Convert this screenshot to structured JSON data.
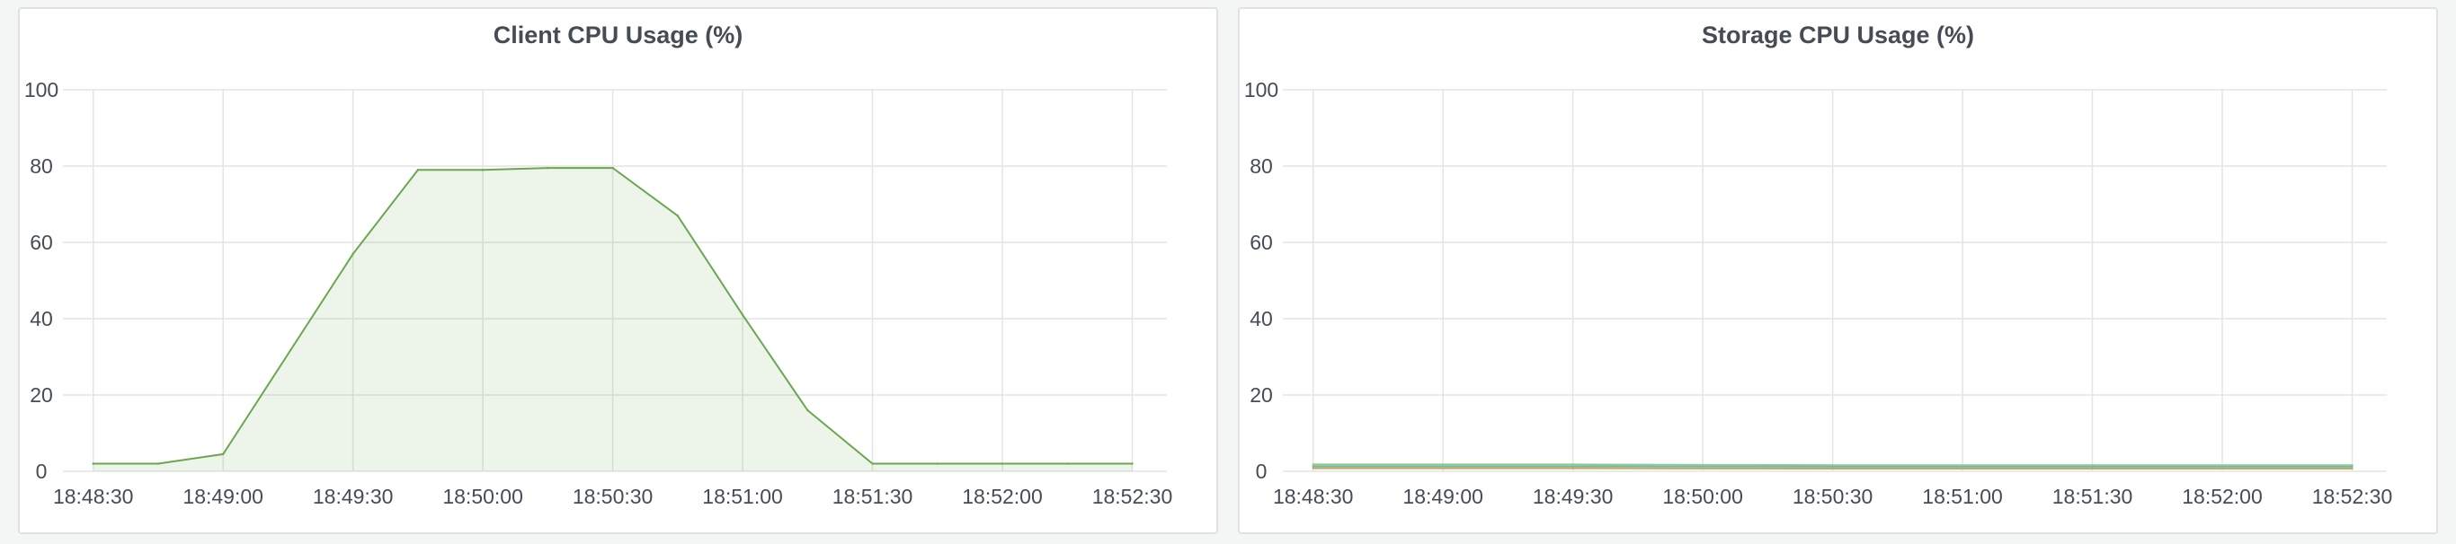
{
  "colors": {
    "grid": "#e4e4e4",
    "axis_text": "#464c54",
    "client_series": "#6aa84f",
    "storage_series": [
      "#8fcf7f",
      "#c9a94d",
      "#6fb5c9"
    ]
  },
  "chart_data": [
    {
      "type": "area",
      "title": "Client CPU Usage (%)",
      "xlabel": "",
      "ylabel": "",
      "ylim": [
        0,
        100
      ],
      "xlim": [
        "18:48:23",
        "18:52:38"
      ],
      "y_ticks": [
        "0",
        "20",
        "40",
        "60",
        "80",
        "100"
      ],
      "x_ticks": [
        "18:48:30",
        "18:49:00",
        "18:49:30",
        "18:50:00",
        "18:50:30",
        "18:51:00",
        "18:51:30",
        "18:52:00",
        "18:52:30"
      ],
      "grid": true,
      "legend": "none",
      "series": [
        {
          "x": [
            "18:48:30",
            "18:48:45",
            "18:49:00",
            "18:49:30",
            "18:49:45",
            "18:50:00",
            "18:50:15",
            "18:50:30",
            "18:50:45",
            "18:51:00",
            "18:51:15",
            "18:51:30",
            "18:51:45",
            "18:52:00",
            "18:52:15",
            "18:52:30"
          ],
          "values": [
            2,
            2,
            4.5,
            57,
            79,
            79,
            79.5,
            79.5,
            67,
            41,
            16,
            2,
            2,
            2,
            2,
            2
          ]
        }
      ]
    },
    {
      "type": "line",
      "title": "Storage CPU Usage (%)",
      "xlabel": "",
      "ylabel": "",
      "ylim": [
        0,
        100
      ],
      "xlim": [
        "18:48:23",
        "18:52:38"
      ],
      "y_ticks": [
        "0",
        "20",
        "40",
        "60",
        "80",
        "100"
      ],
      "x_ticks": [
        "18:48:30",
        "18:49:00",
        "18:49:30",
        "18:50:00",
        "18:50:30",
        "18:51:00",
        "18:51:30",
        "18:52:00",
        "18:52:30"
      ],
      "grid": true,
      "legend": "none",
      "series": [
        {
          "x": [
            "18:48:30",
            "18:49:30",
            "18:50:30",
            "18:51:30",
            "18:52:30"
          ],
          "values": [
            1.8,
            1.8,
            1.6,
            1.6,
            1.6
          ]
        },
        {
          "x": [
            "18:48:30",
            "18:49:30",
            "18:50:30",
            "18:51:30",
            "18:52:30"
          ],
          "values": [
            0.8,
            0.8,
            0.7,
            0.7,
            0.7
          ]
        },
        {
          "x": [
            "18:48:30",
            "18:49:30",
            "18:50:30",
            "18:51:30",
            "18:52:30"
          ],
          "values": [
            1.3,
            1.3,
            1.2,
            1.2,
            1.2
          ]
        }
      ]
    }
  ]
}
